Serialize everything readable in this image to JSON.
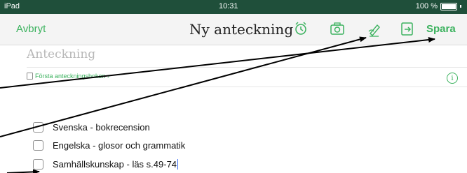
{
  "status_bar": {
    "device": "iPad",
    "time": "10:31",
    "battery": "100 %"
  },
  "nav": {
    "cancel_label": "Avbryt",
    "title": "Ny anteckning",
    "save_label": "Spara",
    "icons": [
      "alarm-icon",
      "camera-icon",
      "handwriting-icon",
      "share-icon"
    ]
  },
  "note": {
    "title_placeholder": "Anteckning",
    "notebook": "Första anteckningsboken ›",
    "info_icon": "i"
  },
  "todos": [
    {
      "label": "Svenska - bokrecension",
      "checked": false
    },
    {
      "label": "Engelska - glosor och grammatik",
      "checked": false
    },
    {
      "label": "Samhällskunskap - läs s.49-74",
      "checked": false
    }
  ],
  "colors": {
    "accent": "#3bb25e",
    "status_bar": "#1f4f3a",
    "caret": "#3b6ef6"
  }
}
